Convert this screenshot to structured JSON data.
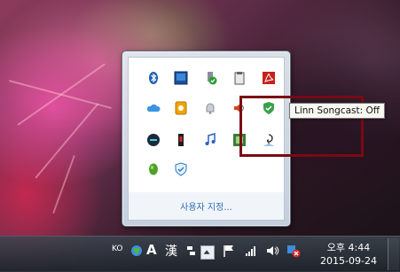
{
  "popup": {
    "customize_label": "사용자 지정...",
    "icons_row1": [
      "bluetooth-icon",
      "network-monitor-icon",
      "power-check-icon",
      "clipboard-icon",
      "acrobat-icon"
    ],
    "icons_row2": [
      "cloud-icon",
      "notes-icon",
      "bell-icon",
      "volume-icon",
      "shield-icon"
    ],
    "icons_row3": [
      "gaming-icon",
      "red-device-icon",
      "music-icon",
      "app-green-icon",
      "linn-songcast-icon"
    ],
    "icons_row4": [
      "green-bean-icon",
      "shield-check-icon"
    ]
  },
  "tooltip": {
    "text": "Linn Songcast: Off"
  },
  "taskbar": {
    "language": "KO",
    "ime_a": "A",
    "ime_han": "漢",
    "time": "오후 4:44",
    "date": "2015-09-24"
  },
  "colors": {
    "highlight": "#7a0a14",
    "link": "#2a6bb3"
  }
}
